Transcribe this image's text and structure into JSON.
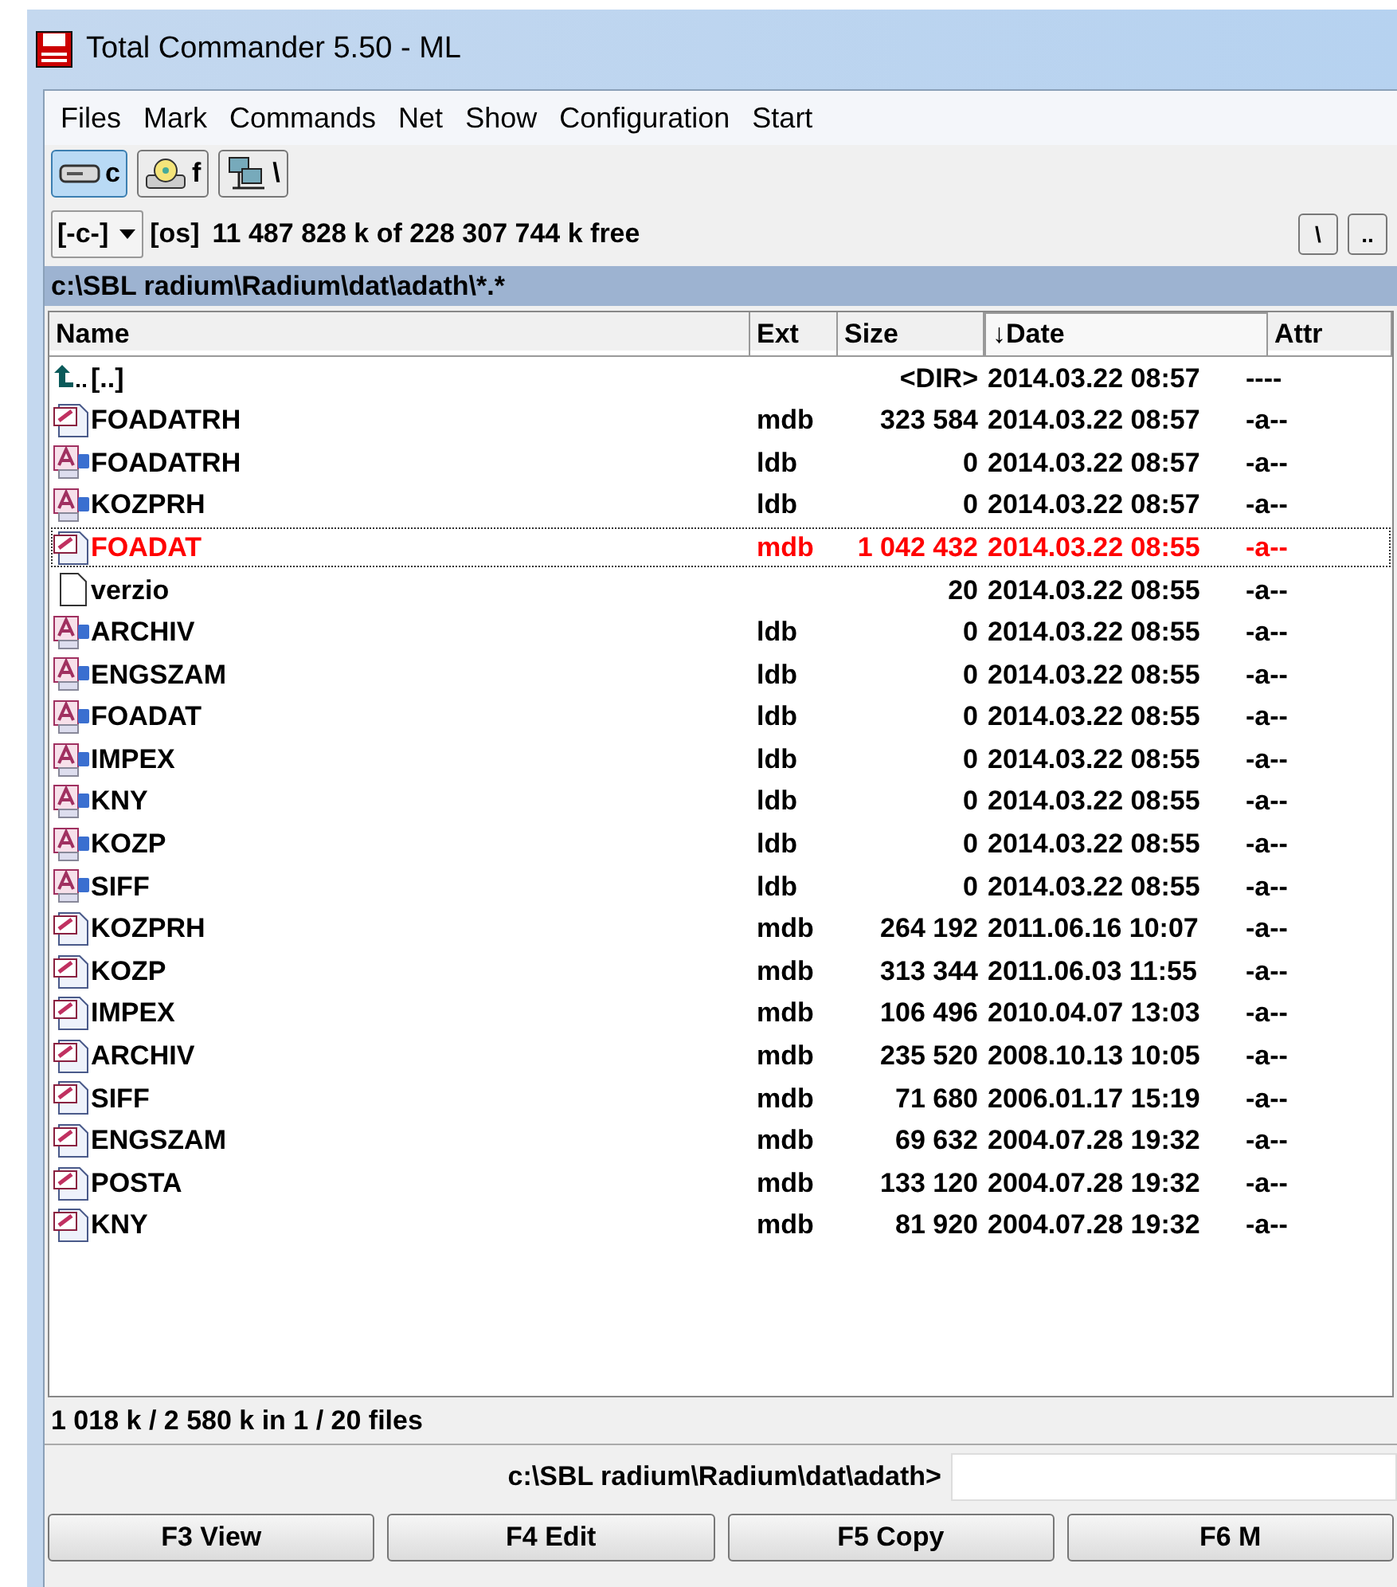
{
  "window": {
    "title": "Total Commander 5.50 - ML"
  },
  "menu": [
    "Files",
    "Mark",
    "Commands",
    "Net",
    "Show",
    "Configuration",
    "Start"
  ],
  "drives": [
    {
      "kind": "hdd",
      "label": "c",
      "selected": true
    },
    {
      "kind": "cdrom",
      "label": "f",
      "selected": false
    },
    {
      "kind": "network",
      "label": "\\",
      "selected": false
    }
  ],
  "drive_bar": {
    "drive": "[-c-]",
    "volume": "[os]",
    "free": "11 487 828 k of 228 307 744 k free",
    "buttons": [
      "\\",
      ".."
    ]
  },
  "path": "c:\\SBL radium\\Radium\\dat\\adath\\*.*",
  "columns": [
    {
      "label": "Name",
      "sorted": false
    },
    {
      "label": "Ext",
      "sorted": false
    },
    {
      "label": "Size",
      "sorted": false
    },
    {
      "label": "↓Date",
      "sorted": true
    },
    {
      "label": "Attr",
      "sorted": false
    }
  ],
  "rows": [
    {
      "kind": "up",
      "name": "[..]",
      "ext": "",
      "size": "<DIR>",
      "date": "2014.03.22 08:57",
      "attr": "----",
      "selected": false
    },
    {
      "kind": "mdb",
      "name": "FOADATRH",
      "ext": "mdb",
      "size": "323 584",
      "date": "2014.03.22 08:57",
      "attr": "-a--",
      "selected": false
    },
    {
      "kind": "ldb",
      "name": "FOADATRH",
      "ext": "ldb",
      "size": "0",
      "date": "2014.03.22 08:57",
      "attr": "-a--",
      "selected": false
    },
    {
      "kind": "ldb",
      "name": "KOZPRH",
      "ext": "ldb",
      "size": "0",
      "date": "2014.03.22 08:57",
      "attr": "-a--",
      "selected": false
    },
    {
      "kind": "mdb",
      "name": "FOADAT",
      "ext": "mdb",
      "size": "1 042 432",
      "date": "2014.03.22 08:55",
      "attr": "-a--",
      "selected": true
    },
    {
      "kind": "file",
      "name": "verzio",
      "ext": "",
      "size": "20",
      "date": "2014.03.22 08:55",
      "attr": "-a--",
      "selected": false
    },
    {
      "kind": "ldb",
      "name": "ARCHIV",
      "ext": "ldb",
      "size": "0",
      "date": "2014.03.22 08:55",
      "attr": "-a--",
      "selected": false
    },
    {
      "kind": "ldb",
      "name": "ENGSZAM",
      "ext": "ldb",
      "size": "0",
      "date": "2014.03.22 08:55",
      "attr": "-a--",
      "selected": false
    },
    {
      "kind": "ldb",
      "name": "FOADAT",
      "ext": "ldb",
      "size": "0",
      "date": "2014.03.22 08:55",
      "attr": "-a--",
      "selected": false
    },
    {
      "kind": "ldb",
      "name": "IMPEX",
      "ext": "ldb",
      "size": "0",
      "date": "2014.03.22 08:55",
      "attr": "-a--",
      "selected": false
    },
    {
      "kind": "ldb",
      "name": "KNY",
      "ext": "ldb",
      "size": "0",
      "date": "2014.03.22 08:55",
      "attr": "-a--",
      "selected": false
    },
    {
      "kind": "ldb",
      "name": "KOZP",
      "ext": "ldb",
      "size": "0",
      "date": "2014.03.22 08:55",
      "attr": "-a--",
      "selected": false
    },
    {
      "kind": "ldb",
      "name": "SIFF",
      "ext": "ldb",
      "size": "0",
      "date": "2014.03.22 08:55",
      "attr": "-a--",
      "selected": false
    },
    {
      "kind": "mdb",
      "name": "KOZPRH",
      "ext": "mdb",
      "size": "264 192",
      "date": "2011.06.16 10:07",
      "attr": "-a--",
      "selected": false
    },
    {
      "kind": "mdb",
      "name": "KOZP",
      "ext": "mdb",
      "size": "313 344",
      "date": "2011.06.03 11:55",
      "attr": "-a--",
      "selected": false
    },
    {
      "kind": "mdb",
      "name": "IMPEX",
      "ext": "mdb",
      "size": "106 496",
      "date": "2010.04.07 13:03",
      "attr": "-a--",
      "selected": false
    },
    {
      "kind": "mdb",
      "name": "ARCHIV",
      "ext": "mdb",
      "size": "235 520",
      "date": "2008.10.13 10:05",
      "attr": "-a--",
      "selected": false
    },
    {
      "kind": "mdb",
      "name": "SIFF",
      "ext": "mdb",
      "size": "71 680",
      "date": "2006.01.17 15:19",
      "attr": "-a--",
      "selected": false
    },
    {
      "kind": "mdb",
      "name": "ENGSZAM",
      "ext": "mdb",
      "size": "69 632",
      "date": "2004.07.28 19:32",
      "attr": "-a--",
      "selected": false
    },
    {
      "kind": "mdb",
      "name": "POSTA",
      "ext": "mdb",
      "size": "133 120",
      "date": "2004.07.28 19:32",
      "attr": "-a--",
      "selected": false
    },
    {
      "kind": "mdb",
      "name": "KNY",
      "ext": "mdb",
      "size": "81 920",
      "date": "2004.07.28 19:32",
      "attr": "-a--",
      "selected": false
    }
  ],
  "status_bar": "1 018 k / 2 580 k in 1 / 20 files",
  "command_line": {
    "prompt": "c:\\SBL radium\\Radium\\dat\\adath>"
  },
  "function_keys": [
    "F3 View",
    "F4 Edit",
    "F5 Copy",
    "F6 M"
  ]
}
